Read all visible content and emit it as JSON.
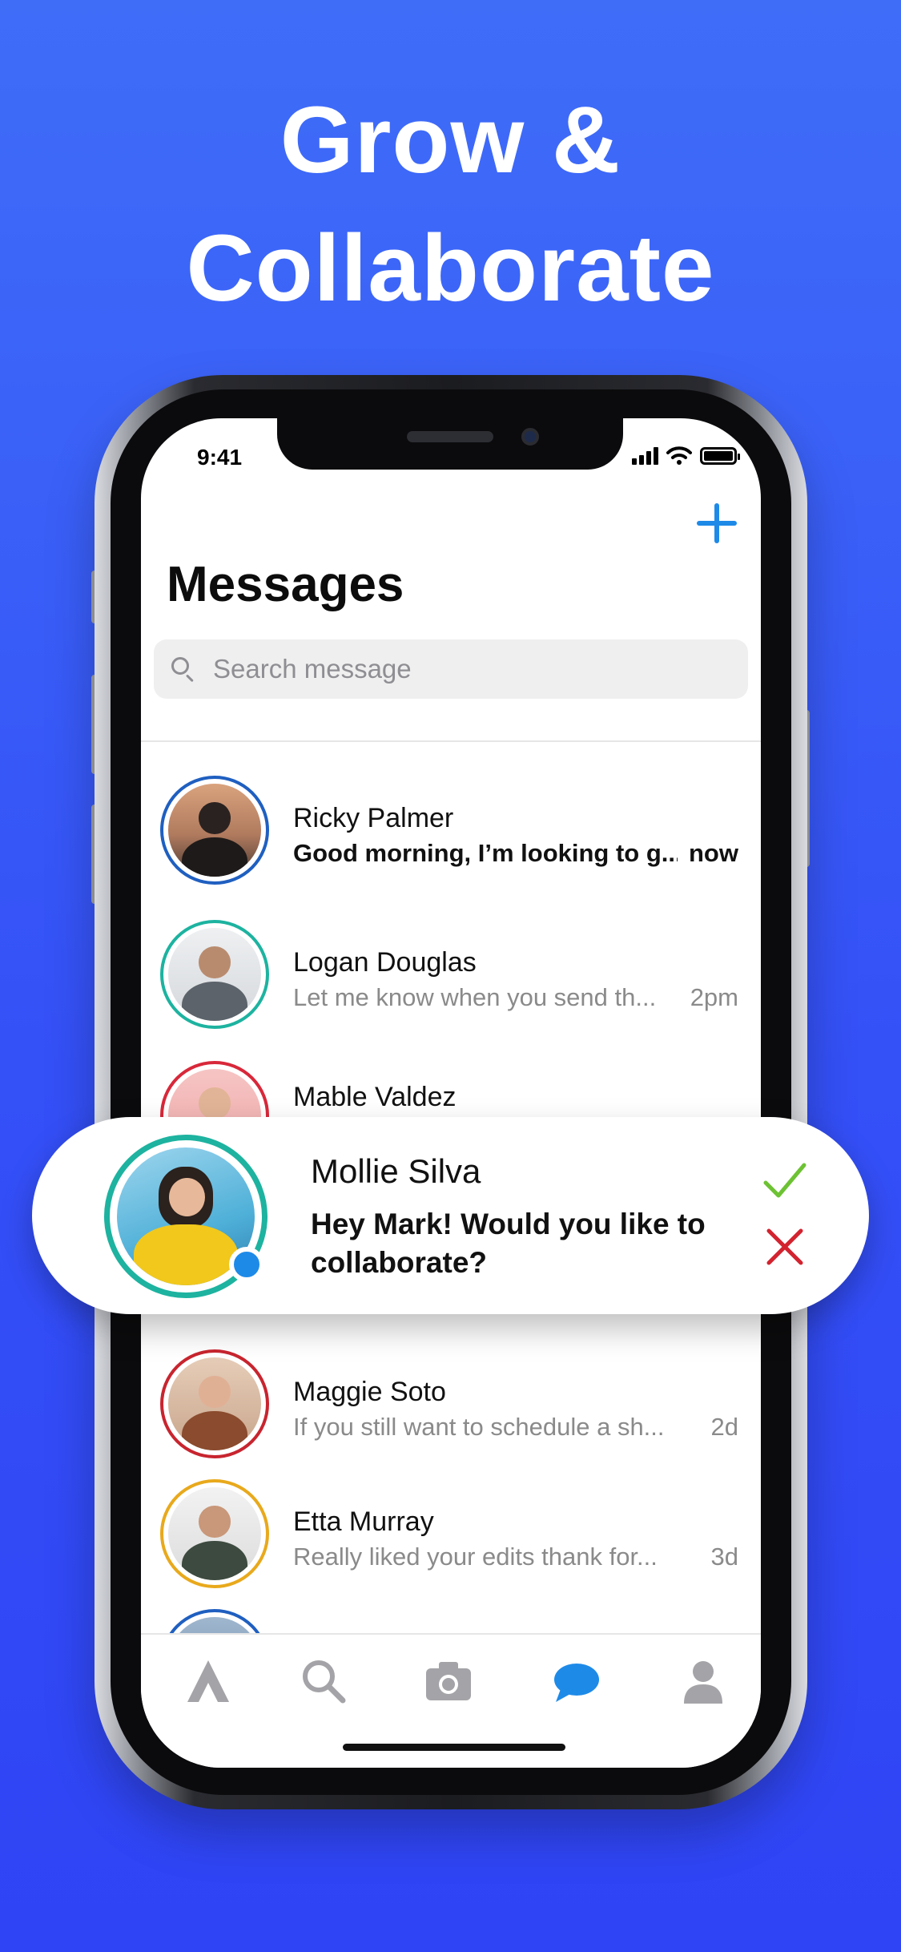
{
  "headline": {
    "line1": "Grow &",
    "line2": "Collaborate"
  },
  "status_bar": {
    "time": "9:41"
  },
  "header": {
    "title": "Messages",
    "add_icon": "plus-icon"
  },
  "search": {
    "placeholder": "Search message"
  },
  "conversations": [
    {
      "name": "Ricky Palmer",
      "preview": "Good morning, I’m looking to g...",
      "time": "now",
      "unread": true,
      "ring_color": "#1f5fc0"
    },
    {
      "name": "Logan Douglas",
      "preview": "Let me know when you send th...",
      "time": "2pm",
      "unread": false,
      "ring_color": "#1db3a0"
    },
    {
      "name": "Mable Valdez",
      "preview": "",
      "time": "",
      "unread": false,
      "ring_color": "#d8283a"
    },
    {
      "name": "Maggie Soto",
      "preview": "If you still want to schedule a sh...",
      "time": "2d",
      "unread": false,
      "ring_color": "#c8252f"
    },
    {
      "name": "Etta Murray",
      "preview": "Really liked your edits thank for...",
      "time": "3d",
      "unread": false,
      "ring_color": "#e8a91c"
    }
  ],
  "request_card": {
    "name": "Mollie Silva",
    "message": "Hey Mark! Would you like to collaborate?",
    "ring_color": "#1db3a0",
    "online_color": "#1e8ae8",
    "accept_icon": "checkmark-icon",
    "decline_icon": "x-mark-icon",
    "accept_color": "#6dc234",
    "decline_color": "#d3232f"
  },
  "tabbar": {
    "items": [
      "home-icon",
      "search-icon",
      "camera-icon",
      "chat-icon",
      "profile-icon"
    ],
    "active": "chat-icon",
    "active_color": "#1e8ae8",
    "inactive_color": "#a4a4a8"
  },
  "colors": {
    "accent": "#1e8ae8",
    "background_top": "#3f6df8",
    "background_bottom": "#2f44f5"
  }
}
